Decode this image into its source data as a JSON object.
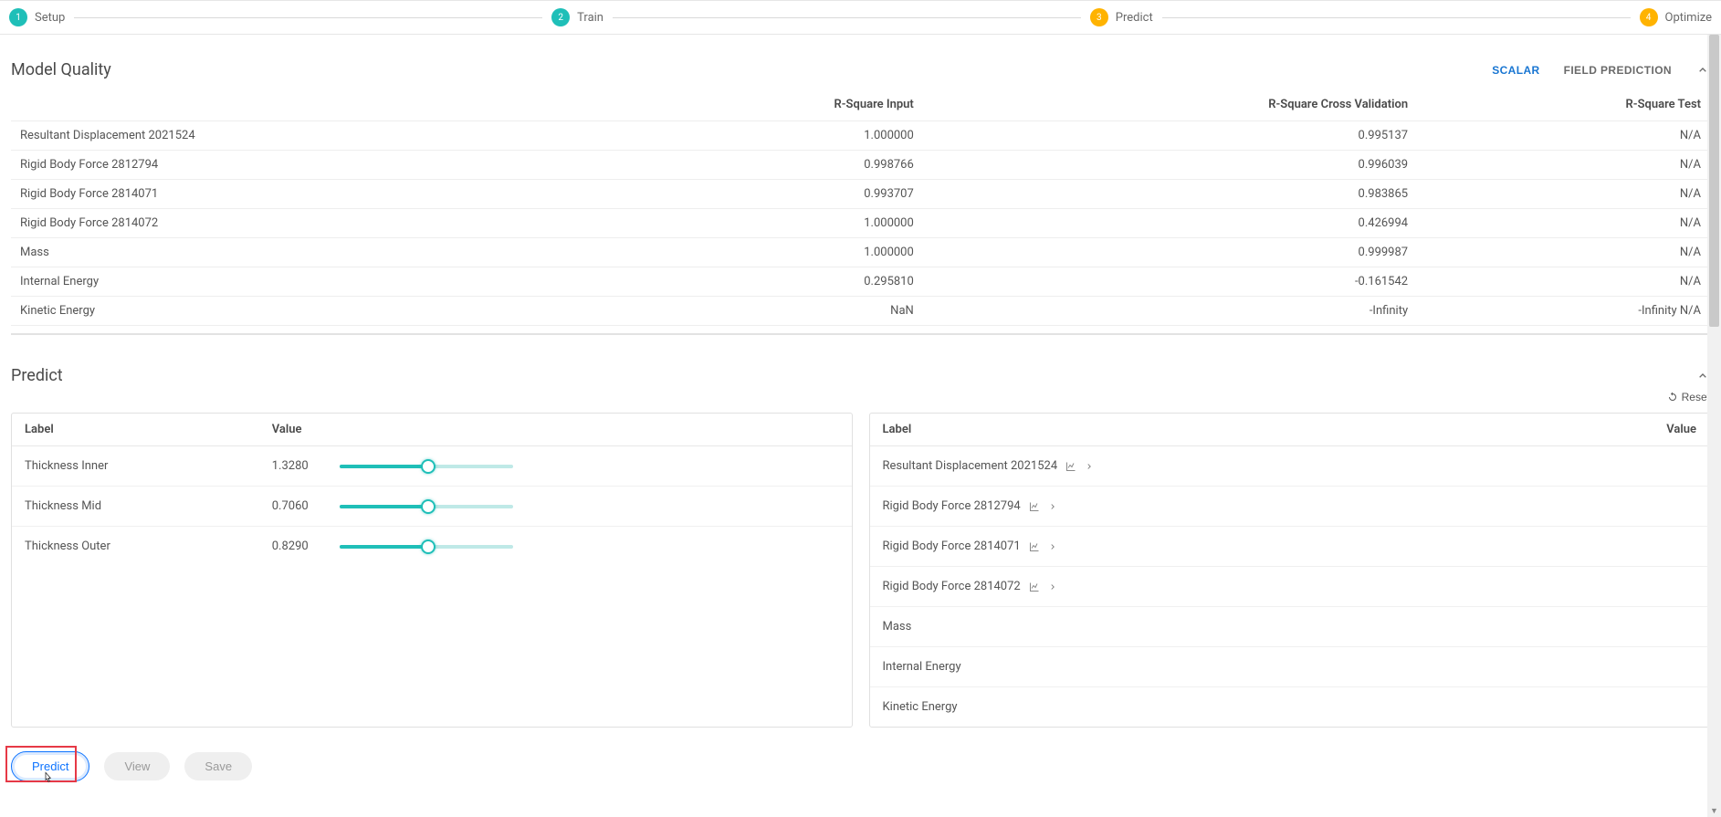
{
  "stepper": {
    "steps": [
      {
        "num": "1",
        "label": "Setup",
        "color": "teal"
      },
      {
        "num": "2",
        "label": "Train",
        "color": "teal"
      },
      {
        "num": "3",
        "label": "Predict",
        "color": "amber"
      },
      {
        "num": "4",
        "label": "Optimize",
        "color": "amber"
      }
    ]
  },
  "model_quality": {
    "title": "Model Quality",
    "tabs": {
      "scalar": "SCALAR",
      "field": "FIELD PREDICTION"
    },
    "headers": [
      "",
      "R-Square Input",
      "R-Square Cross Validation",
      "R-Square Test"
    ],
    "rows": [
      {
        "label": "Resultant Displacement 2021524",
        "rsi": "1.000000",
        "rscv": "0.995137",
        "rst": "N/A"
      },
      {
        "label": "Rigid Body Force 2812794",
        "rsi": "0.998766",
        "rscv": "0.996039",
        "rst": "N/A"
      },
      {
        "label": "Rigid Body Force 2814071",
        "rsi": "0.993707",
        "rscv": "0.983865",
        "rst": "N/A"
      },
      {
        "label": "Rigid Body Force 2814072",
        "rsi": "1.000000",
        "rscv": "0.426994",
        "rst": "N/A"
      },
      {
        "label": "Mass",
        "rsi": "1.000000",
        "rscv": "0.999987",
        "rst": "N/A"
      },
      {
        "label": "Internal Energy",
        "rsi": "0.295810",
        "rscv": "-0.161542",
        "rst": "N/A"
      },
      {
        "label": "Kinetic Energy",
        "rsi": "NaN",
        "rscv": "-Infinity",
        "rst": "-Infinity N/A"
      }
    ]
  },
  "predict": {
    "title": "Predict",
    "reset_label": "Reset",
    "input_headers": {
      "label": "Label",
      "value": "Value"
    },
    "inputs": [
      {
        "label": "Thickness Inner",
        "value": "1.3280",
        "pct": 51
      },
      {
        "label": "Thickness Mid",
        "value": "0.7060",
        "pct": 51
      },
      {
        "label": "Thickness Outer",
        "value": "0.8290",
        "pct": 51
      }
    ],
    "output_headers": {
      "label": "Label",
      "value": "Value"
    },
    "outputs": [
      {
        "label": "Resultant Displacement 2021524",
        "expandable": true
      },
      {
        "label": "Rigid Body Force 2812794",
        "expandable": true
      },
      {
        "label": "Rigid Body Force 2814071",
        "expandable": true
      },
      {
        "label": "Rigid Body Force 2814072",
        "expandable": true
      },
      {
        "label": "Mass",
        "expandable": false
      },
      {
        "label": "Internal Energy",
        "expandable": false
      },
      {
        "label": "Kinetic Energy",
        "expandable": false
      }
    ],
    "buttons": {
      "predict": "Predict",
      "view": "View",
      "save": "Save"
    }
  }
}
